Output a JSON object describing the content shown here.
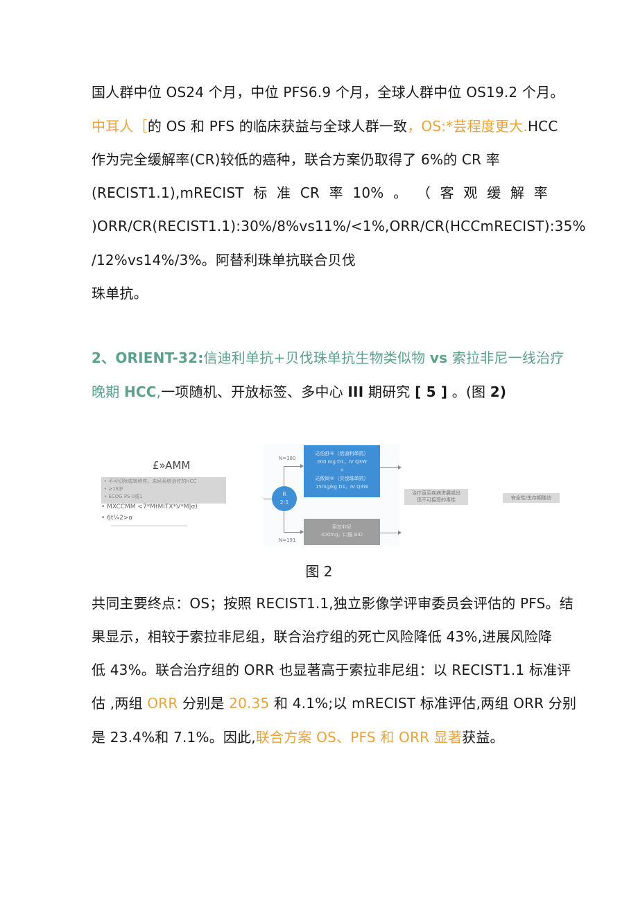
{
  "paragraph1": {
    "line1": "国人群中位 OS24 个月，中位 PFS6.9 个月，全球人群中位 OS19.2 个月。",
    "line2_orange_a": "中耳人［",
    "line2_black": "的 OS 和 PFS 的临床获益与全球人群一致",
    "line2_orange_b": "，OS:*芸程度更大.",
    "line2_black_end": "HCC",
    "line3": "作为完全缓解率(CR)较低的癌种，联合方案仍取得了 6%的 CR 率",
    "line4_words": [
      "(RECIST1.1),mRECIST",
      "标",
      "准",
      "CR",
      "率",
      "10%",
      "。",
      "（",
      "客",
      "观",
      "缓",
      "解",
      "率"
    ],
    "line5": ")ORR/CR(RECIST1.1):30%/8%vs11%/<1%,ORR/CR(HCCmRECIST):35%",
    "line6": "/12%vs14%/3%。阿替利珠单抗联合贝伐",
    "line7": "珠单抗。"
  },
  "section2": {
    "heading_num": "2、ORIENT-32:",
    "heading_a": "信迪利单抗+贝伐珠单抗生物类似物 ",
    "heading_vs": "vs",
    "heading_b": " 索拉非尼一线治疗",
    "line2_green": "晚期 ",
    "line2_green_bold": "HCC",
    "line2_green_comma": ",",
    "line2_black_a": "一项随机、开放标签、多中心 ",
    "line2_bold_roman": "III",
    "line2_black_b": " 期研究 ",
    "line2_bold_ref": "[ 5 ]",
    "line2_black_c": " 。(图 ",
    "line2_bold_fig": "2)"
  },
  "figure2": {
    "eligibility_title": "£»AMM",
    "eligibility_box_items": [
      "不可切除或转移性，未经系统治疗的HCC",
      "≥18岁",
      "ECOG PS 0或1"
    ],
    "eligibility_items": [
      "MXCCMM <7*MtMITX*V*M|σ)",
      "6t¼2>α"
    ],
    "randomization": "R",
    "ratio": "2:1",
    "arm1_n": "N=380",
    "arm2_n": "N=191",
    "arm1_lines": [
      "达伯舒®（信迪利单抗）",
      "200 mg D1，IV Q3W",
      "+",
      "达攸同®（贝伐珠单抗）",
      "15mg/kg D1，IV Q3W"
    ],
    "arm2_lines": [
      "索拉非尼",
      "400mg，口服 BID"
    ],
    "outcome_lines": [
      "治疗直至疾病进展或出",
      "现不可接受的毒性"
    ],
    "followup_label": "安全性/生存期随访",
    "caption": "图 2"
  },
  "paragraph2": {
    "line1": "共同主要终点：OS；按照 RECIST1.1,独立影像学评审委员会评估的 PFS。结",
    "line2": "果显示，相较于索拉非尼组，联合治疗组的死亡风险降低 43%,进展风险降",
    "line3": "低 43%。联合治疗组的 ORR 也显著高于索拉非尼组：以 RECIST1.1 标准评",
    "line4_a": "估 ,两组 ",
    "line4_orange_a": "ORR",
    "line4_b": " 分别是 ",
    "line4_orange_b": "20.35",
    "line4_c": " 和 4.1%;以 mRECIST 标准评估,两组 ORR 分别",
    "line5_a": "是 23.4%和 7.1%。因此,",
    "line5_orange": "联合方案 OS、PFS 和 ORR 显著",
    "line5_b": "获益。"
  }
}
